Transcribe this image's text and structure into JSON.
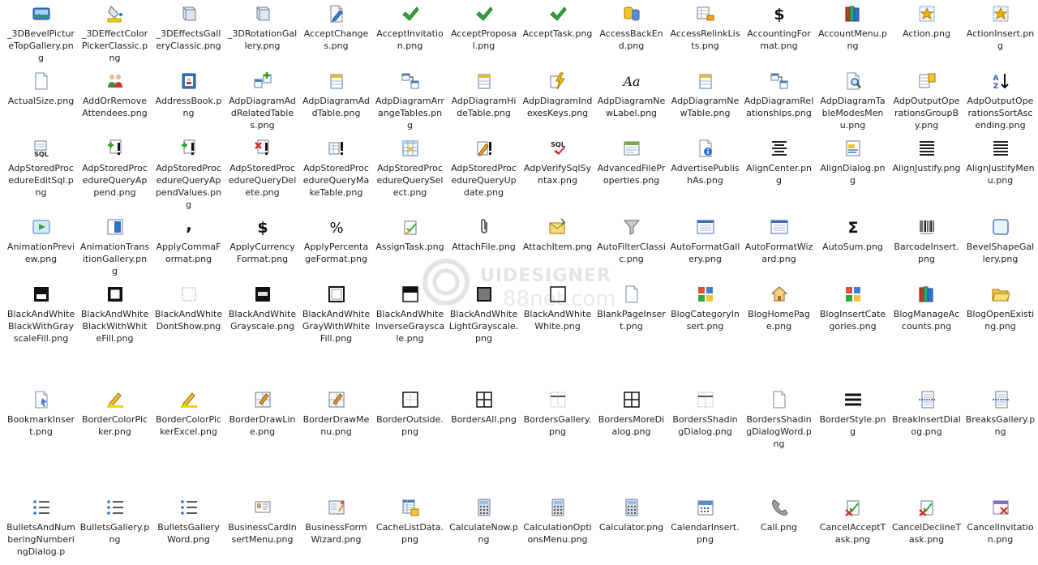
{
  "watermark": {
    "title": "UIDESIGNER",
    "sub": "88net.com"
  },
  "rows": [
    [
      {
        "label": "_3DBevelPictureTopGallery.png",
        "icon": "picture-3d-icon"
      },
      {
        "label": "_3DEffectColorPickerClassic.png",
        "icon": "paint-bucket-icon"
      },
      {
        "label": "_3DEffectsGalleryClassic.png",
        "icon": "cube-3d-icon"
      },
      {
        "label": "_3DRotationGallery.png",
        "icon": "cube-3d-icon"
      },
      {
        "label": "AcceptChanges.png",
        "icon": "document-pen-icon"
      },
      {
        "label": "AcceptInvitation.png",
        "icon": "checkmark-icon"
      },
      {
        "label": "AcceptProposal.png",
        "icon": "checkmark-icon"
      },
      {
        "label": "AcceptTask.png",
        "icon": "checkmark-icon"
      },
      {
        "label": "AccessBackEnd.png",
        "icon": "database-icon"
      },
      {
        "label": "AccessRelinkLists.png",
        "icon": "table-link-icon"
      },
      {
        "label": "AccountingFormat.png",
        "icon": "dollar-icon"
      },
      {
        "label": "AccountMenu.png",
        "icon": "books-icon"
      },
      {
        "label": "Action.png",
        "icon": "action-star-icon"
      },
      {
        "label": "ActionInsert.png",
        "icon": "action-star-icon"
      }
    ],
    [
      {
        "label": "ActualSize.png",
        "icon": "document-icon"
      },
      {
        "label": "AddOrRemoveAttendees.png",
        "icon": "people-icon"
      },
      {
        "label": "AddressBook.png",
        "icon": "address-book-icon"
      },
      {
        "label": "AdpDiagramAddRelatedTables.png",
        "icon": "diagram-add-icon"
      },
      {
        "label": "AdpDiagramAddTable.png",
        "icon": "diagram-table-icon"
      },
      {
        "label": "AdpDiagramArrangeTables.png",
        "icon": "diagram-arrange-icon"
      },
      {
        "label": "AdpDiagramHideTable.png",
        "icon": "diagram-table-icon"
      },
      {
        "label": "AdpDiagramIndexesKeys.png",
        "icon": "lightning-icon"
      },
      {
        "label": "AdpDiagramNewLabel.png",
        "icon": "font-aa-icon"
      },
      {
        "label": "AdpDiagramNewTable.png",
        "icon": "diagram-table-icon"
      },
      {
        "label": "AdpDiagramRelationships.png",
        "icon": "diagram-arrange-icon"
      },
      {
        "label": "AdpDiagramTableModesMenu.png",
        "icon": "magnifier-icon"
      },
      {
        "label": "AdpOutputOperationsGroupBy.png",
        "icon": "sort-icon"
      },
      {
        "label": "AdpOutputOperationsSortAscending.png",
        "icon": "sort-az-icon"
      }
    ],
    [
      {
        "label": "AdpStoredProcedureEditSql.png",
        "icon": "sql-icon"
      },
      {
        "label": "AdpStoredProcedureQueryAppend.png",
        "icon": "plus-exclaim-icon"
      },
      {
        "label": "AdpStoredProcedureQueryAppendValues.png",
        "icon": "plus-exclaim-icon"
      },
      {
        "label": "AdpStoredProcedureQueryDelete.png",
        "icon": "delete-exclaim-icon"
      },
      {
        "label": "AdpStoredProcedureQueryMakeTable.png",
        "icon": "table-exclaim-icon"
      },
      {
        "label": "AdpStoredProcedureQuerySelect.png",
        "icon": "table-grid-icon"
      },
      {
        "label": "AdpStoredProcedureQueryUpdate.png",
        "icon": "pencil-exclaim-icon"
      },
      {
        "label": "AdpVerifySqlSyntax.png",
        "icon": "sql-check-icon"
      },
      {
        "label": "AdvancedFileProperties.png",
        "icon": "file-properties-icon"
      },
      {
        "label": "AdvertisePublishAs.png",
        "icon": "document-info-icon"
      },
      {
        "label": "AlignCenter.png",
        "icon": "align-center-icon"
      },
      {
        "label": "AlignDialog.png",
        "icon": "align-dialog-icon"
      },
      {
        "label": "AlignJustify.png",
        "icon": "align-justify-icon"
      },
      {
        "label": "AlignJustifyMenu.png",
        "icon": "align-justify-icon"
      }
    ],
    [
      {
        "label": "AnimationPreview.png",
        "icon": "animation-preview-icon"
      },
      {
        "label": "AnimationTransitionGallery.png",
        "icon": "transition-icon"
      },
      {
        "label": "ApplyCommaFormat.png",
        "icon": "comma-icon"
      },
      {
        "label": "ApplyCurrencyFormat.png",
        "icon": "dollar-icon"
      },
      {
        "label": "ApplyPercentageFormat.png",
        "icon": "percent-icon"
      },
      {
        "label": "AssignTask.png",
        "icon": "assign-task-icon"
      },
      {
        "label": "AttachFile.png",
        "icon": "paperclip-icon"
      },
      {
        "label": "AttachItem.png",
        "icon": "envelope-icon"
      },
      {
        "label": "AutoFilterClassic.png",
        "icon": "funnel-icon"
      },
      {
        "label": "AutoFormatGallery.png",
        "icon": "window-icon"
      },
      {
        "label": "AutoFormatWizard.png",
        "icon": "window-icon"
      },
      {
        "label": "AutoSum.png",
        "icon": "sigma-icon"
      },
      {
        "label": "BarcodeInsert.png",
        "icon": "barcode-icon"
      },
      {
        "label": "BevelShapeGallery.png",
        "icon": "bevel-shape-icon"
      }
    ],
    [
      {
        "label": "BlackAndWhiteBlackWithGrayscaleFill.png",
        "icon": "bw-black-gray-icon"
      },
      {
        "label": "BlackAndWhiteBlackWithWhiteFill.png",
        "icon": "bw-black-white-icon"
      },
      {
        "label": "BlackAndWhiteDontShow.png",
        "icon": "bw-dontshow-icon"
      },
      {
        "label": "BlackAndWhiteGrayscale.png",
        "icon": "bw-grayscale-icon"
      },
      {
        "label": "BlackAndWhiteGrayWithWhiteFill.png",
        "icon": "bw-gray-white-icon"
      },
      {
        "label": "BlackAndWhiteInverseGrayscale.png",
        "icon": "bw-inverse-icon"
      },
      {
        "label": "BlackAndWhiteLightGrayscale.png",
        "icon": "bw-light-icon"
      },
      {
        "label": "BlackAndWhiteWhite.png",
        "icon": "bw-white-icon"
      },
      {
        "label": "BlankPageInsert.png",
        "icon": "blank-page-icon"
      },
      {
        "label": "BlogCategoryInsert.png",
        "icon": "category-grid-icon"
      },
      {
        "label": "BlogHomePage.png",
        "icon": "house-icon"
      },
      {
        "label": "BlogInsertCategories.png",
        "icon": "category-grid-icon"
      },
      {
        "label": "BlogManageAccounts.png",
        "icon": "books-icon"
      },
      {
        "label": "BlogOpenExisting.png",
        "icon": "folder-open-icon"
      }
    ],
    [
      {
        "label": "BookmarkInsert.png",
        "icon": "bookmark-doc-icon"
      },
      {
        "label": "BorderColorPicker.png",
        "icon": "pencil-border-icon"
      },
      {
        "label": "BorderColorPickerExcel.png",
        "icon": "pencil-border-icon"
      },
      {
        "label": "BorderDrawLine.png",
        "icon": "border-draw-icon"
      },
      {
        "label": "BorderDrawMenu.png",
        "icon": "border-draw-icon"
      },
      {
        "label": "BorderOutside.png",
        "icon": "border-outside-icon"
      },
      {
        "label": "BordersAll.png",
        "icon": "borders-all-icon"
      },
      {
        "label": "BordersGallery.png",
        "icon": "borders-gallery-icon"
      },
      {
        "label": "BordersMoreDialog.png",
        "icon": "borders-all-icon"
      },
      {
        "label": "BordersShadingDialog.png",
        "icon": "borders-gallery-icon"
      },
      {
        "label": "BordersShadingDialogWord.png",
        "icon": "blank-page-icon"
      },
      {
        "label": "BorderStyle.png",
        "icon": "border-style-icon"
      },
      {
        "label": "BreakInsertDialog.png",
        "icon": "page-break-icon"
      },
      {
        "label": "BreaksGallery.png",
        "icon": "page-break-icon"
      }
    ],
    [
      {
        "label": "BulletsAndNumberingNumberingDialog.p",
        "icon": "bullet-list-icon"
      },
      {
        "label": "BulletsGallery.png",
        "icon": "bullet-list-icon"
      },
      {
        "label": "BulletsGalleryWord.png",
        "icon": "bullet-list-icon"
      },
      {
        "label": "BusinessCardInsertMenu.png",
        "icon": "business-card-icon"
      },
      {
        "label": "BusinessFormWizard.png",
        "icon": "form-wizard-icon"
      },
      {
        "label": "CacheListData.png",
        "icon": "cache-list-icon"
      },
      {
        "label": "CalculateNow.png",
        "icon": "calculator-icon"
      },
      {
        "label": "CalculationOptionsMenu.png",
        "icon": "calculator-icon"
      },
      {
        "label": "Calculator.png",
        "icon": "calculator-icon"
      },
      {
        "label": "CalendarInsert.png",
        "icon": "calendar-icon"
      },
      {
        "label": "Call.png",
        "icon": "phone-icon"
      },
      {
        "label": "CancelAcceptTask.png",
        "icon": "cancel-task-icon"
      },
      {
        "label": "CancelDeclineTask.png",
        "icon": "cancel-task-icon"
      },
      {
        "label": "CancelInvitation.png",
        "icon": "cancel-calendar-icon"
      }
    ]
  ]
}
